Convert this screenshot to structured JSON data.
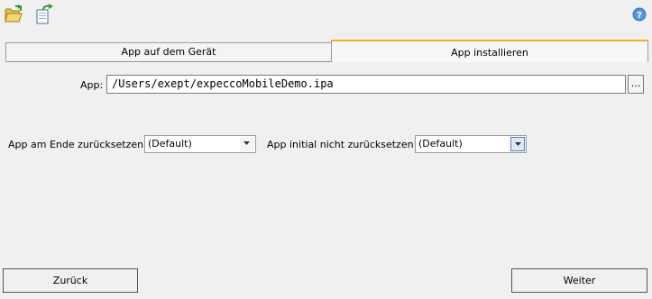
{
  "toolbar": {
    "icons": [
      "open-folder-icon",
      "export-icon",
      "help-icon"
    ]
  },
  "tabs": [
    {
      "label": "App auf dem Gerät",
      "active": false
    },
    {
      "label": "App installieren",
      "active": true
    }
  ],
  "form": {
    "app_label": "App:",
    "app_value": "/Users/exept/expeccoMobileDemo.ipa",
    "browse_label": "...",
    "reset_end_label": "App am Ende zurücksetzen:",
    "reset_end_value": "(Default)",
    "no_reset_initial_label": "App initial nicht zurücksetzen:",
    "no_reset_initial_value": "(Default)"
  },
  "footer": {
    "back_label": "Zurück",
    "next_label": "Weiter"
  },
  "colors": {
    "background": "#f0f0f0",
    "active_tab_accent": "#f0b030",
    "help_icon": "#3a78c8"
  }
}
